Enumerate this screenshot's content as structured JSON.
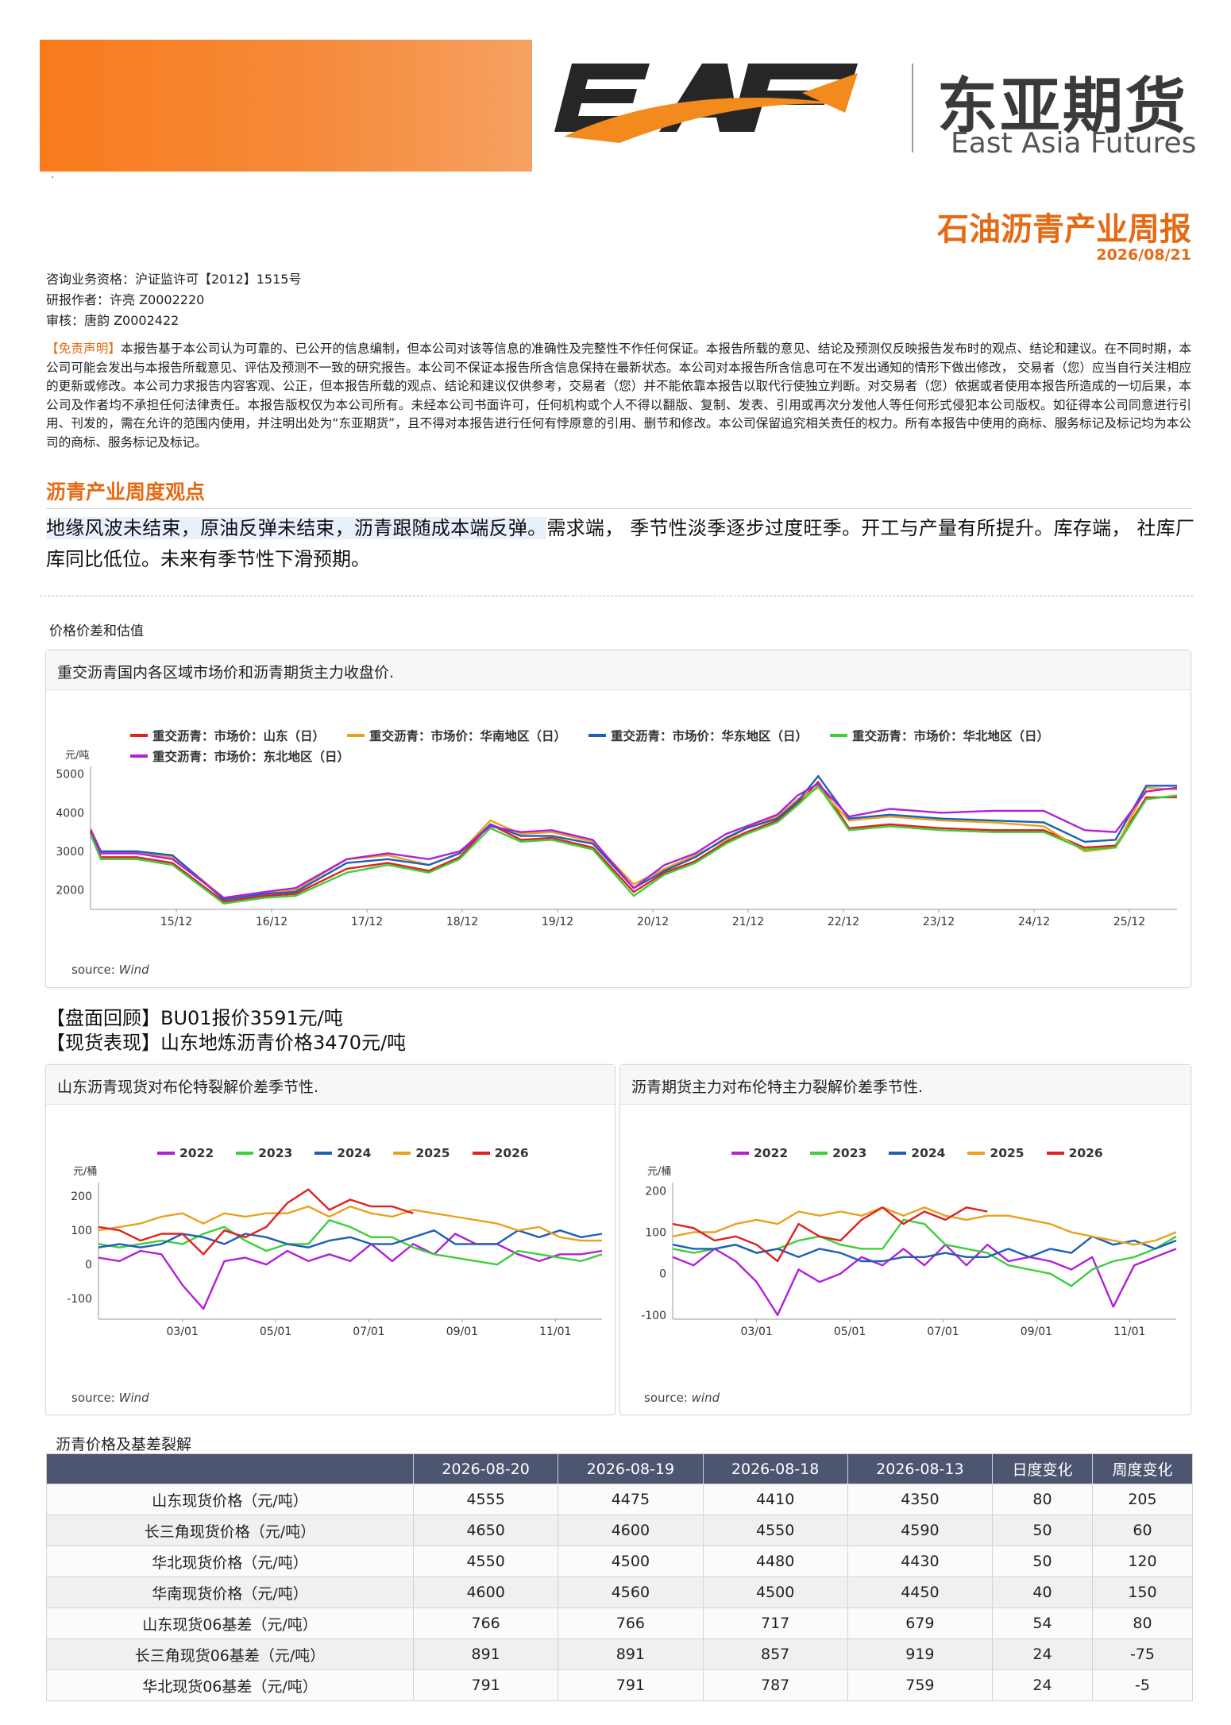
{
  "header": {
    "logo_mark": "EAF",
    "company_cn": "东亚期货",
    "company_en": "East Asia Futures",
    "dot": "·",
    "report_title": "石油沥青产业周报",
    "report_date": "2026/08/21"
  },
  "meta": {
    "license": "咨询业务资格：沪证监许可【2012】1515号",
    "researcher": "研报作者：许亮 Z0002220",
    "reviewer": "审核：唐韵 Z0002422"
  },
  "disclaimer": {
    "tag": "【免责声明】",
    "text": "本报告基于本公司认为可靠的、已公开的信息编制，但本公司对该等信息的准确性及完整性不作任何保证。本报告所载的意见、结论及预测仅反映报告发布时的观点、结论和建议。在不同时期，本公司可能会发出与本报告所载意见、评估及预测不一致的研究报告。本公司不保证本报告所含信息保持在最新状态。本公司对本报告所含信息可在不发出通知的情形下做出修改， 交易者（您）应当自行关注相应的更新或修改。本公司力求报告内容客观、公正，但本报告所载的观点、结论和建议仅供参考，交易者（您）并不能依靠本报告以取代行使独立判断。对交易者（您）依据或者使用本报告所造成的一切后果，本公司及作者均不承担任何法律责任。本报告版权仅为本公司所有。未经本公司书面许可，任何机构或个人不得以翻版、复制、发表、引用或再次分发他人等任何形式侵犯本公司版权。如征得本公司同意进行引用、刊发的，需在允许的范围内使用，并注明出处为“东亚期货”，且不得对本报告进行任何有悖原意的引用、删节和修改。本公司保留追究相关责任的权力。所有本报告中使用的商标、服务标记及标记均为本公司的商标、服务标记及标记。"
  },
  "view": {
    "heading": "沥青产业周度观点",
    "highlight": "地缘风波未结束，原油反弹未结束，沥青跟随成本端反弹。",
    "rest": "需求端， 季节性淡季逐步过度旺季。开工与产量有所提升。库存端， 社库厂库同比低位。未来有季节性下滑预期。"
  },
  "section_label": "价格价差和估值",
  "colors": {
    "accent": "#e56a13",
    "red": "#e0211f",
    "orange": "#e8a21c",
    "blue": "#1f5fb5",
    "green": "#3ccf3c",
    "purple": "#b31fd8",
    "table_header": "#4d5570"
  },
  "review": {
    "futures": "【盘面回顾】BU01报价3591元/吨",
    "spot": "【现货表现】山东地炼沥青价格3470元/吨"
  },
  "chart_data": [
    {
      "type": "line",
      "title": "重交沥青国内各区域市场价和沥青期货主力收盘价.",
      "ylabel": "元/吨",
      "source_label": "source:",
      "source_value": "Wind",
      "categories": [
        "15/12",
        "16/12",
        "17/12",
        "18/12",
        "19/12",
        "20/12",
        "21/12",
        "22/12",
        "23/12",
        "24/12",
        "25/12"
      ],
      "ylim": [
        1500,
        5200
      ],
      "yticks": [
        2000,
        3000,
        4000,
        5000
      ],
      "x": [
        0,
        0.1,
        0.45,
        0.8,
        1.0,
        1.3,
        1.7,
        2.0,
        2.5,
        2.9,
        3.3,
        3.6,
        3.9,
        4.2,
        4.5,
        4.9,
        5.3,
        5.6,
        5.9,
        6.2,
        6.4,
        6.7,
        6.9,
        7.1,
        7.4,
        7.8,
        8.3,
        8.8,
        9.3,
        9.7,
        10.0,
        10.3,
        10.6
      ],
      "series": [
        {
          "name": "重交沥青：市场价：山东（日）",
          "color": "#e0211f",
          "values": [
            3500,
            2850,
            2850,
            2700,
            2300,
            1700,
            1850,
            1900,
            2550,
            2700,
            2500,
            2850,
            3700,
            3300,
            3350,
            3100,
            1950,
            2450,
            2750,
            3250,
            3500,
            3800,
            4250,
            4800,
            3600,
            3700,
            3600,
            3550,
            3550,
            3100,
            3150,
            4400,
            4400
          ]
        },
        {
          "name": "重交沥青：市场价：华南地区（日）",
          "color": "#e8a21c",
          "values": [
            3600,
            3000,
            3000,
            2850,
            2450,
            1800,
            1900,
            2000,
            2800,
            2900,
            2650,
            2950,
            3800,
            3450,
            3500,
            3250,
            2150,
            2550,
            2900,
            3300,
            3600,
            3900,
            4350,
            4650,
            3800,
            3900,
            3800,
            3750,
            3650,
            3000,
            3100,
            4650,
            4600
          ]
        },
        {
          "name": "重交沥青：市场价：华东地区（日）",
          "color": "#1f5fb5",
          "values": [
            3550,
            3000,
            3000,
            2900,
            2450,
            1750,
            1900,
            1950,
            2700,
            2800,
            2650,
            2950,
            3700,
            3400,
            3400,
            3200,
            2050,
            2500,
            2850,
            3350,
            3600,
            3850,
            4300,
            4950,
            3850,
            3950,
            3850,
            3800,
            3750,
            3250,
            3300,
            4700,
            4700
          ]
        },
        {
          "name": "重交沥青：市场价：华北地区（日）",
          "color": "#3ccf3c",
          "values": [
            3450,
            2800,
            2800,
            2650,
            2250,
            1650,
            1800,
            1850,
            2450,
            2650,
            2450,
            2800,
            3600,
            3250,
            3300,
            3050,
            1850,
            2400,
            2700,
            3200,
            3450,
            3750,
            4200,
            4700,
            3550,
            3650,
            3550,
            3500,
            3500,
            3050,
            3100,
            4350,
            4450
          ]
        },
        {
          "name": "重交沥青：市场价：东北地区（日）",
          "color": "#b31fd8",
          "values": [
            3550,
            2950,
            2950,
            2800,
            2400,
            1800,
            1950,
            2050,
            2800,
            2950,
            2800,
            3000,
            3650,
            3500,
            3550,
            3300,
            2050,
            2650,
            2950,
            3450,
            3650,
            3950,
            4450,
            4750,
            3900,
            4100,
            4000,
            4050,
            4050,
            3550,
            3500,
            4550,
            4650
          ]
        }
      ]
    },
    {
      "type": "line",
      "title": "山东沥青现货对布伦特裂解价差季节性.",
      "ylabel": "元/桶",
      "source_label": "source:",
      "source_value": "Wind",
      "categories": [
        "03/01",
        "05/01",
        "07/01",
        "09/01",
        "11/01"
      ],
      "ylim": [
        -160,
        240
      ],
      "yticks": [
        -100,
        0,
        100,
        200
      ],
      "x": [
        0,
        15,
        30,
        45,
        60,
        75,
        90,
        105,
        120,
        135,
        150,
        165,
        180,
        195,
        210,
        225,
        240,
        255,
        270,
        285,
        300,
        315,
        330,
        345,
        360
      ],
      "series": [
        {
          "name": "2022",
          "color": "#b31fd8",
          "values": [
            20,
            10,
            40,
            30,
            -60,
            -130,
            10,
            20,
            0,
            40,
            10,
            30,
            10,
            60,
            10,
            60,
            30,
            90,
            60,
            60,
            30,
            10,
            30,
            30,
            40
          ]
        },
        {
          "name": "2023",
          "color": "#3ccf3c",
          "values": [
            60,
            50,
            60,
            70,
            60,
            90,
            110,
            70,
            40,
            60,
            60,
            130,
            110,
            80,
            80,
            50,
            30,
            20,
            10,
            0,
            40,
            30,
            20,
            10,
            30
          ]
        },
        {
          "name": "2024",
          "color": "#1f5fb5",
          "values": [
            50,
            60,
            50,
            60,
            90,
            80,
            60,
            90,
            80,
            60,
            50,
            70,
            80,
            60,
            60,
            80,
            100,
            60,
            60,
            60,
            100,
            80,
            100,
            80,
            90
          ]
        },
        {
          "name": "2025",
          "color": "#e8a21c",
          "values": [
            100,
            110,
            120,
            140,
            150,
            120,
            150,
            140,
            150,
            150,
            170,
            140,
            170,
            150,
            140,
            160,
            150,
            140,
            130,
            120,
            100,
            110,
            80,
            70,
            70
          ]
        },
        {
          "name": "2026",
          "color": "#e0211f",
          "values": [
            110,
            100,
            70,
            90,
            90,
            30,
            100,
            80,
            110,
            180,
            220,
            160,
            190,
            170,
            170,
            150
          ]
        }
      ]
    },
    {
      "type": "line",
      "title": "沥青期货主力对布伦特主力裂解价差季节性.",
      "ylabel": "元/桶",
      "source_label": "source:",
      "source_value": "wind",
      "categories": [
        "03/01",
        "05/01",
        "07/01",
        "09/01",
        "11/01"
      ],
      "ylim": [
        -110,
        220
      ],
      "yticks": [
        -100,
        0,
        100,
        200
      ],
      "x": [
        0,
        15,
        30,
        45,
        60,
        75,
        90,
        105,
        120,
        135,
        150,
        165,
        180,
        195,
        210,
        225,
        240,
        255,
        270,
        285,
        300,
        315,
        330,
        345,
        360
      ],
      "series": [
        {
          "name": "2022",
          "color": "#b31fd8",
          "values": [
            40,
            20,
            60,
            30,
            -20,
            -100,
            10,
            -20,
            0,
            40,
            20,
            60,
            20,
            70,
            20,
            70,
            30,
            40,
            30,
            10,
            40,
            -80,
            20,
            40,
            60
          ]
        },
        {
          "name": "2023",
          "color": "#3ccf3c",
          "values": [
            60,
            50,
            60,
            70,
            50,
            60,
            80,
            90,
            70,
            60,
            60,
            130,
            120,
            70,
            60,
            50,
            20,
            10,
            0,
            -30,
            10,
            30,
            40,
            60,
            90
          ]
        },
        {
          "name": "2024",
          "color": "#1f5fb5",
          "values": [
            70,
            60,
            60,
            70,
            50,
            60,
            40,
            60,
            50,
            30,
            30,
            40,
            40,
            50,
            40,
            40,
            60,
            40,
            60,
            50,
            90,
            70,
            80,
            60,
            80
          ]
        },
        {
          "name": "2025",
          "color": "#e8a21c",
          "values": [
            90,
            100,
            100,
            120,
            130,
            120,
            150,
            140,
            150,
            140,
            160,
            140,
            160,
            140,
            130,
            140,
            140,
            130,
            120,
            100,
            90,
            80,
            70,
            80,
            100
          ]
        },
        {
          "name": "2026",
          "color": "#e0211f",
          "values": [
            120,
            110,
            80,
            90,
            70,
            30,
            120,
            90,
            80,
            130,
            160,
            120,
            150,
            130,
            160,
            150
          ]
        }
      ]
    }
  ],
  "table": {
    "title": "沥青价格及基差裂解",
    "headers": [
      "",
      "2026-08-20",
      "2026-08-19",
      "2026-08-18",
      "2026-08-13",
      "日度变化",
      "周度变化"
    ],
    "rows": [
      [
        "山东现货价格（元/吨）",
        "4555",
        "4475",
        "4410",
        "4350",
        "80",
        "205"
      ],
      [
        "长三角现货价格（元/吨）",
        "4650",
        "4600",
        "4550",
        "4590",
        "50",
        "60"
      ],
      [
        "华北现货价格（元/吨）",
        "4550",
        "4500",
        "4480",
        "4430",
        "50",
        "120"
      ],
      [
        "华南现货价格（元/吨）",
        "4600",
        "4560",
        "4500",
        "4450",
        "40",
        "150"
      ],
      [
        "山东现货06基差（元/吨）",
        "766",
        "766",
        "717",
        "679",
        "54",
        "80"
      ],
      [
        "长三角现货06基差（元/吨）",
        "891",
        "891",
        "857",
        "919",
        "24",
        "-75"
      ],
      [
        "华北现货06基差（元/吨）",
        "791",
        "791",
        "787",
        "759",
        "24",
        "-5"
      ]
    ]
  }
}
